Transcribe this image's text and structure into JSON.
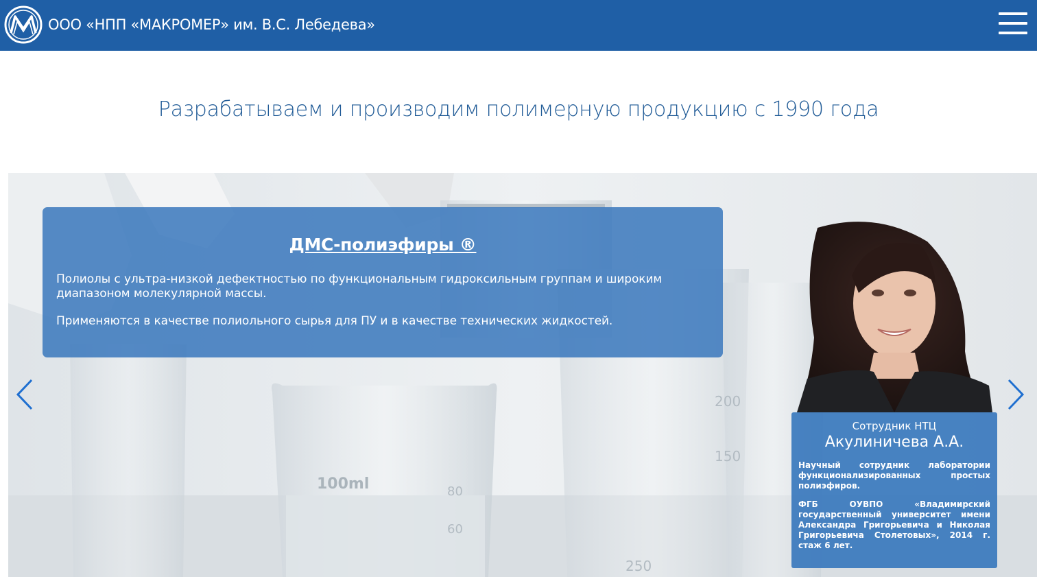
{
  "header": {
    "company_name": "ООО «НПП «МАКРОМЕР» им. В.С. Лебедева»",
    "menu_icon": "hamburger-menu-icon",
    "logo_icon": "makromer-logo-icon"
  },
  "tagline": "Разрабатываем и производим полимерную продукцию с 1990 года",
  "slide": {
    "title": "ДМС-полиэфиры ®",
    "paragraph_1": "Полиолы с ультра-низкой дефектностью по функциональным гидроксильным группам и широким диапазоном молекулярной массы.",
    "paragraph_2": "Применяются в качестве полиольного сырья для ПУ и в качестве технических жидкостей.",
    "prev_icon": "chevron-left-icon",
    "next_icon": "chevron-right-icon"
  },
  "staff": {
    "role": "Сотрудник НТЦ",
    "name": "Акулиничева А.А.",
    "position": "Научный сотрудник лаборатории функционализированных простых полиэфиров.",
    "education": "ФГБ ОУВПО «Владимирский государственный университет имени Александра Григорьевича и Николая Григорьевича Столетовых», 2014 г. стаж 6 лет."
  },
  "colors": {
    "brand_blue": "#1f5fa6",
    "tagline_blue": "#1f5a96",
    "card_blue": "#3a78bd"
  }
}
